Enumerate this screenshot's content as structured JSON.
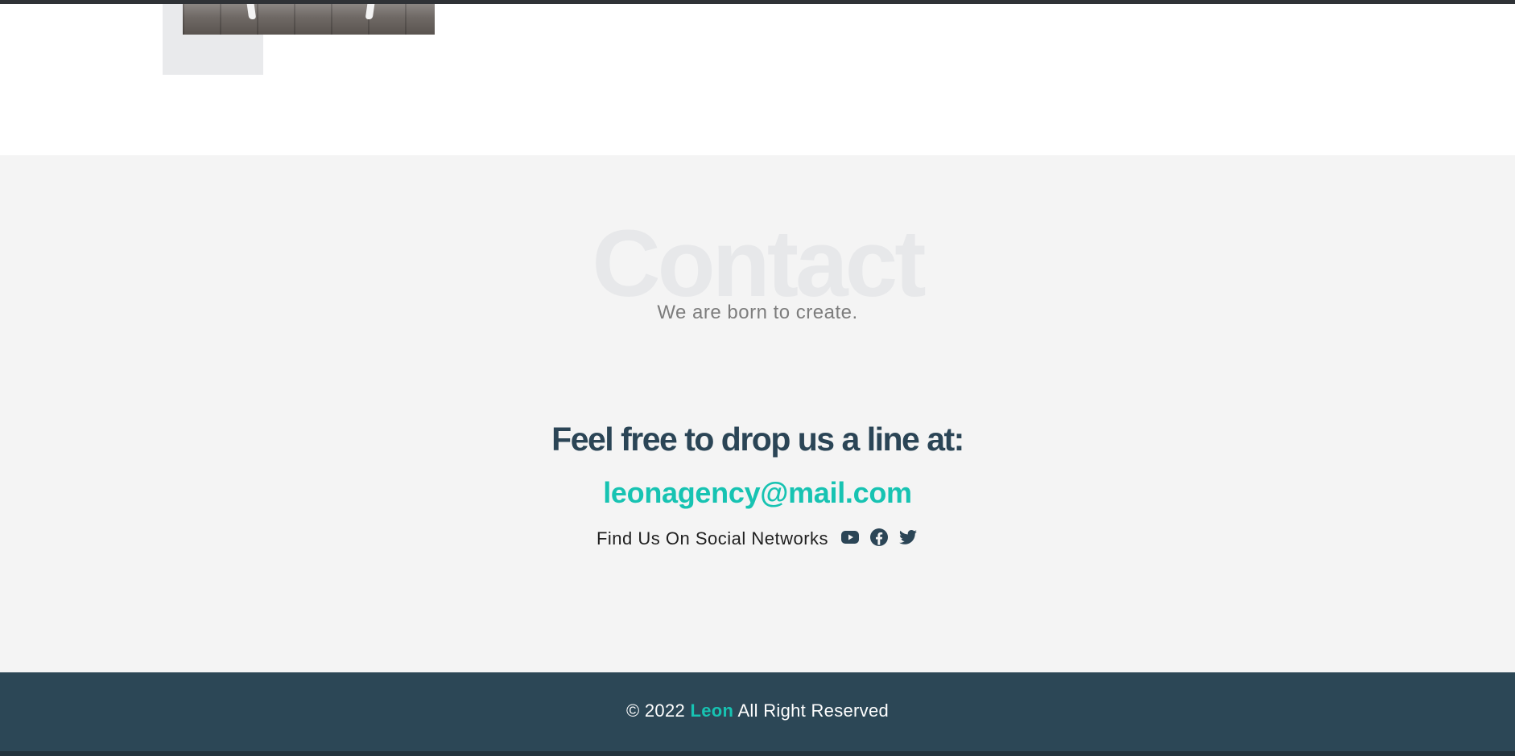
{
  "contact": {
    "background_title": "Contact",
    "subtitle": "We are born to create.",
    "heading": "Feel free to drop us a line at:",
    "email": "leonagency@mail.com",
    "social_label": "Find Us On Social Networks",
    "social_icons": [
      "youtube-icon",
      "facebook-icon",
      "twitter-icon"
    ]
  },
  "footer": {
    "copyright": "© 2022",
    "brand": "Leon",
    "rights": "All Right Reserved"
  },
  "colors": {
    "accent": "#17c3b2",
    "heading": "#2b4556",
    "footer_bg": "#2c4756",
    "section_bg": "#f4f4f4"
  }
}
